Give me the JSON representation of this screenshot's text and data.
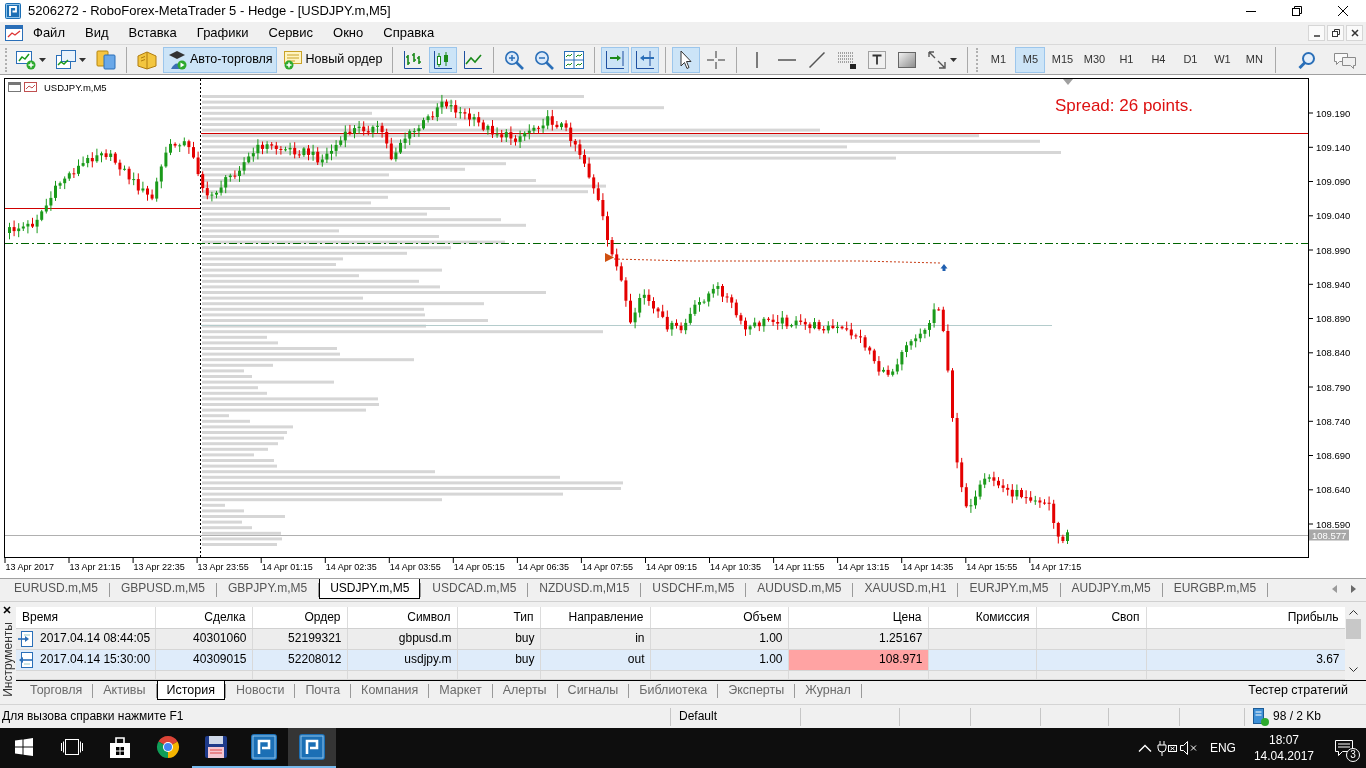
{
  "window": {
    "title": "5206272 - RoboForex-MetaTrader 5 - Hedge - [USDJPY.m,M5]"
  },
  "menu": [
    "Файл",
    "Вид",
    "Вставка",
    "Графики",
    "Сервис",
    "Окно",
    "Справка"
  ],
  "toolbar": [
    [
      {
        "pressed": false
      },
      {
        "pressed": false
      },
      {
        "pressed": false
      }
    ],
    [
      {
        "pressed": false
      },
      {
        "label": "Авто-торговля",
        "pressed": true
      },
      {
        "label": "Новый ордер",
        "pressed": false
      }
    ],
    [
      {
        "pressed": false
      },
      {
        "pressed": true
      },
      {
        "pressed": false
      }
    ],
    [
      {
        "pressed": false
      },
      {
        "pressed": false
      },
      {
        "pressed": false
      }
    ],
    [
      {
        "pressed": true
      },
      {
        "pressed": true
      }
    ],
    [
      {
        "pressed": true
      },
      {
        "pressed": false
      }
    ],
    [
      {
        "pressed": false
      },
      {
        "pressed": false
      },
      {
        "pressed": false
      },
      {
        "pressed": false
      },
      {
        "pressed": false
      },
      {
        "pressed": false
      },
      {
        "pressed": false
      }
    ]
  ],
  "timeframes": [
    {
      "label": "M1",
      "selected": false
    },
    {
      "label": "M5",
      "selected": true
    },
    {
      "label": "M15",
      "selected": false
    },
    {
      "label": "M30",
      "selected": false
    },
    {
      "label": "H1",
      "selected": false
    },
    {
      "label": "H4",
      "selected": false
    },
    {
      "label": "D1",
      "selected": false
    },
    {
      "label": "W1",
      "selected": false
    },
    {
      "label": "MN",
      "selected": false
    }
  ],
  "chart": {
    "title": "USDJPY.m,M5",
    "spread": "Spread: 26 points.",
    "price_labels": [
      "109.190",
      "109.140",
      "109.090",
      "109.040",
      "108.990",
      "108.940",
      "108.890",
      "108.840",
      "108.790",
      "108.740",
      "108.690",
      "108.640",
      "108.590"
    ],
    "current_price": "108.577",
    "time_labels": [
      "13 Apr 2017",
      "13 Apr 21:15",
      "13 Apr 22:35",
      "13 Apr 23:55",
      "14 Apr 01:15",
      "14 Apr 02:35",
      "14 Apr 03:55",
      "14 Apr 05:15",
      "14 Apr 06:35",
      "14 Apr 07:55",
      "14 Apr 09:15",
      "14 Apr 10:35",
      "14 Apr 11:55",
      "14 Apr 13:15",
      "14 Apr 14:35",
      "14 Apr 15:55",
      "14 Apr 17:15"
    ]
  },
  "chart_tabs": [
    {
      "label": "EURUSD.m,M5",
      "selected": false
    },
    {
      "label": "GBPUSD.m,M5",
      "selected": false
    },
    {
      "label": "GBPJPY.m,M5",
      "selected": false
    },
    {
      "label": "USDJPY.m,M5",
      "selected": true
    },
    {
      "label": "USDCAD.m,M5",
      "selected": false
    },
    {
      "label": "NZDUSD.m,M15",
      "selected": false
    },
    {
      "label": "USDCHF.m,M5",
      "selected": false
    },
    {
      "label": "AUDUSD.m,M5",
      "selected": false
    },
    {
      "label": "XAUUSD.m,H1",
      "selected": false
    },
    {
      "label": "EURJPY.m,M5",
      "selected": false
    },
    {
      "label": "AUDJPY.m,M5",
      "selected": false
    },
    {
      "label": "EURGBP.m,M5",
      "selected": false
    }
  ],
  "toolbox": {
    "title": "Инструменты",
    "columns": [
      "Время",
      "Сделка",
      "Ордер",
      "Символ",
      "Тип",
      "Направление",
      "Объем",
      "Цена",
      "Комиссия",
      "Своп",
      "Прибыль"
    ],
    "rows": [
      {
        "kind": "entry",
        "selected": false,
        "time": "2017.04.14 08:44:05",
        "deal": "40301060",
        "order": "52199321",
        "symbol": "gbpusd.m",
        "type": "buy",
        "direction": "in",
        "volume": "1.00",
        "price": "1.25167",
        "price_marked": false
      },
      {
        "kind": "exit",
        "selected": true,
        "time": "2017.04.14 15:30:00",
        "deal": "40309015",
        "order": "52208012",
        "symbol": "usdjpy.m",
        "type": "buy",
        "direction": "out",
        "volume": "1.00",
        "price": "108.971",
        "price_marked": true,
        "profit": "3.67"
      }
    ],
    "tabs": [
      {
        "label": "Торговля",
        "selected": false
      },
      {
        "label": "Активы",
        "selected": false
      },
      {
        "label": "История",
        "selected": true
      },
      {
        "label": "Новости",
        "selected": false
      },
      {
        "label": "Почта",
        "selected": false
      },
      {
        "label": "Компания",
        "selected": false
      },
      {
        "label": "Маркет",
        "selected": false
      },
      {
        "label": "Алерты",
        "selected": false
      },
      {
        "label": "Сигналы",
        "selected": false
      },
      {
        "label": "Библиотека",
        "selected": false
      },
      {
        "label": "Эксперты",
        "selected": false
      },
      {
        "label": "Журнал",
        "selected": false
      }
    ],
    "tester_tab": "Тестер стратегий"
  },
  "status_bar": {
    "hint": "Для вызова справки нажмите F1",
    "profile": "Default",
    "traffic": "98 / 2 Kb"
  },
  "taskbar": {
    "apps": [
      {
        "running": false,
        "selected": false
      },
      {
        "running": false,
        "selected": false
      },
      {
        "running": true,
        "selected": false
      },
      {
        "running": true,
        "selected": false
      },
      {
        "running": true,
        "selected": true
      }
    ],
    "language": "ENG",
    "time": "18:07",
    "date": "14.04.2017",
    "notifications": "3"
  }
}
